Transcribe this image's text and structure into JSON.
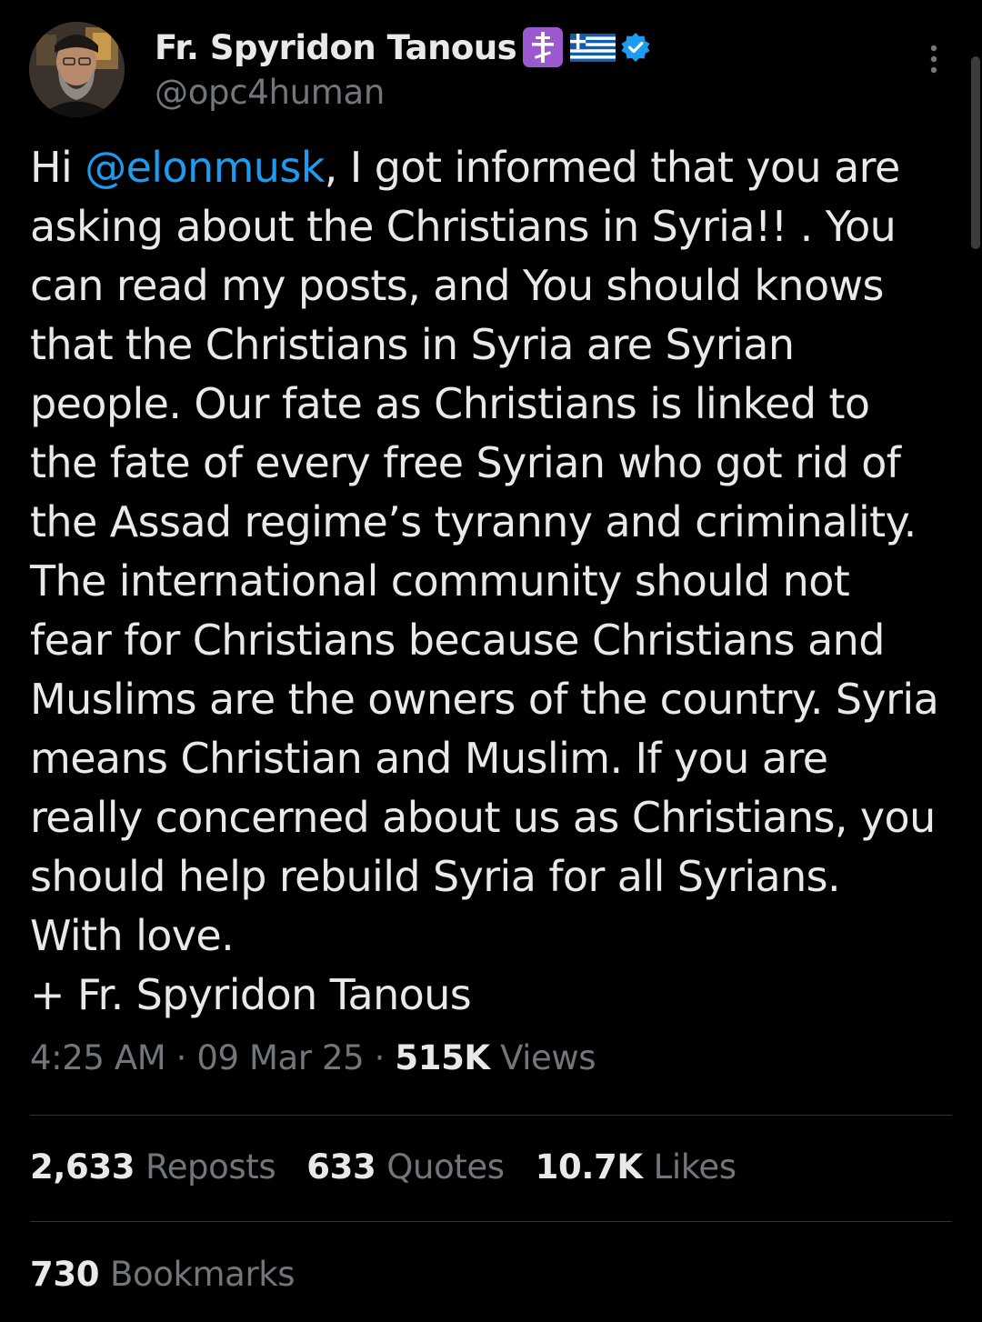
{
  "post": {
    "author": {
      "display_name": "Fr. Spyridon Tanous",
      "handle": "@opc4human",
      "avatar": "profile-photo",
      "name_emojis": [
        "orthodox-cross-emoji",
        "greece-flag-emoji"
      ],
      "verified": true
    },
    "body": {
      "greeting": "Hi ",
      "mention": "@elonmusk",
      "text": ", I got informed that you are\nasking about the Christians in Syria!! . You\ncan read my posts, and You should knows\nthat the Christians in Syria are Syrian\npeople. Our fate as Christians is linked to\nthe fate of every free Syrian who got rid of\nthe Assad regime’s tyranny and criminality.\nThe international community should not\nfear for Christians because Christians and\nMuslims are the owners of the country. Syria\nmeans Christian and Muslim. If you are\nreally concerned about us as Christians, you\nshould help rebuild Syria for all Syrians.\nWith love.\n+ Fr. Spyridon Tanous"
    },
    "meta": {
      "time": "4:25 AM",
      "separator": " · ",
      "date": "09 Mar 25",
      "views_count": "515K",
      "views_label": " Views"
    },
    "stats": {
      "reposts": {
        "count": "2,633",
        "label": "Reposts"
      },
      "quotes": {
        "count": "633",
        "label": "Quotes"
      },
      "likes": {
        "count": "10.7K",
        "label": "Likes"
      },
      "bookmarks": {
        "count": "730",
        "label": "Bookmarks"
      }
    }
  },
  "colors": {
    "background": "#000000",
    "text_primary": "#e7e9ea",
    "text_secondary": "#71767b",
    "link": "#1d9bf0",
    "divider": "#2f3336",
    "verified": "#1d9bf0"
  },
  "icons": {
    "more": "more-vertical-icon",
    "verified": "verified-badge-icon"
  }
}
